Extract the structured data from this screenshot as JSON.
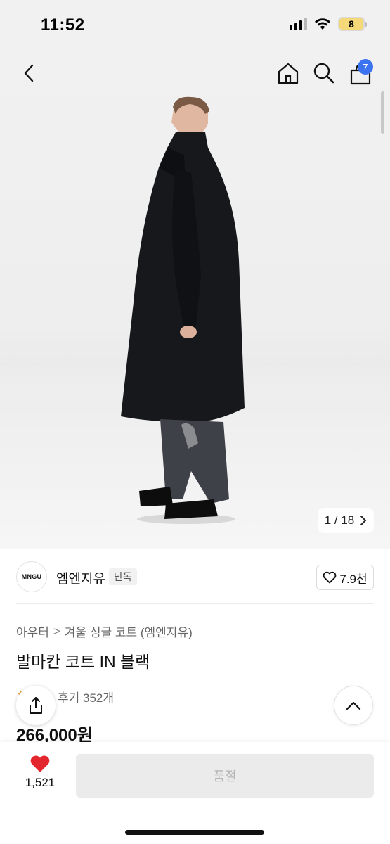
{
  "status": {
    "time": "11:52",
    "battery": "8",
    "signal": "signal-icon",
    "wifi": "wifi-icon"
  },
  "nav": {
    "back": "back-icon",
    "home": "home-icon",
    "search": "search-icon",
    "cart": "cart-icon",
    "cart_badge": "7"
  },
  "gallery": {
    "counter": "1 / 18",
    "next": "chevron-right-icon"
  },
  "brand": {
    "logo_text": "MNGU",
    "name": "엠엔지유",
    "badge": "단독",
    "likes": "7.9천"
  },
  "breadcrumb": {
    "level1": "아우터",
    "separator": ">",
    "level2": "겨울 싱글 코트 (엠엔지유)"
  },
  "product": {
    "title": "발마칸 코트 IN 블랙",
    "review_link": "후기 352개",
    "price": "266,000원"
  },
  "bottom": {
    "wish_count": "1,521",
    "soldout_label": "품절"
  },
  "colors": {
    "accent": "#3b73f0",
    "heart": "#e3262d",
    "star": "#e8a23a"
  }
}
